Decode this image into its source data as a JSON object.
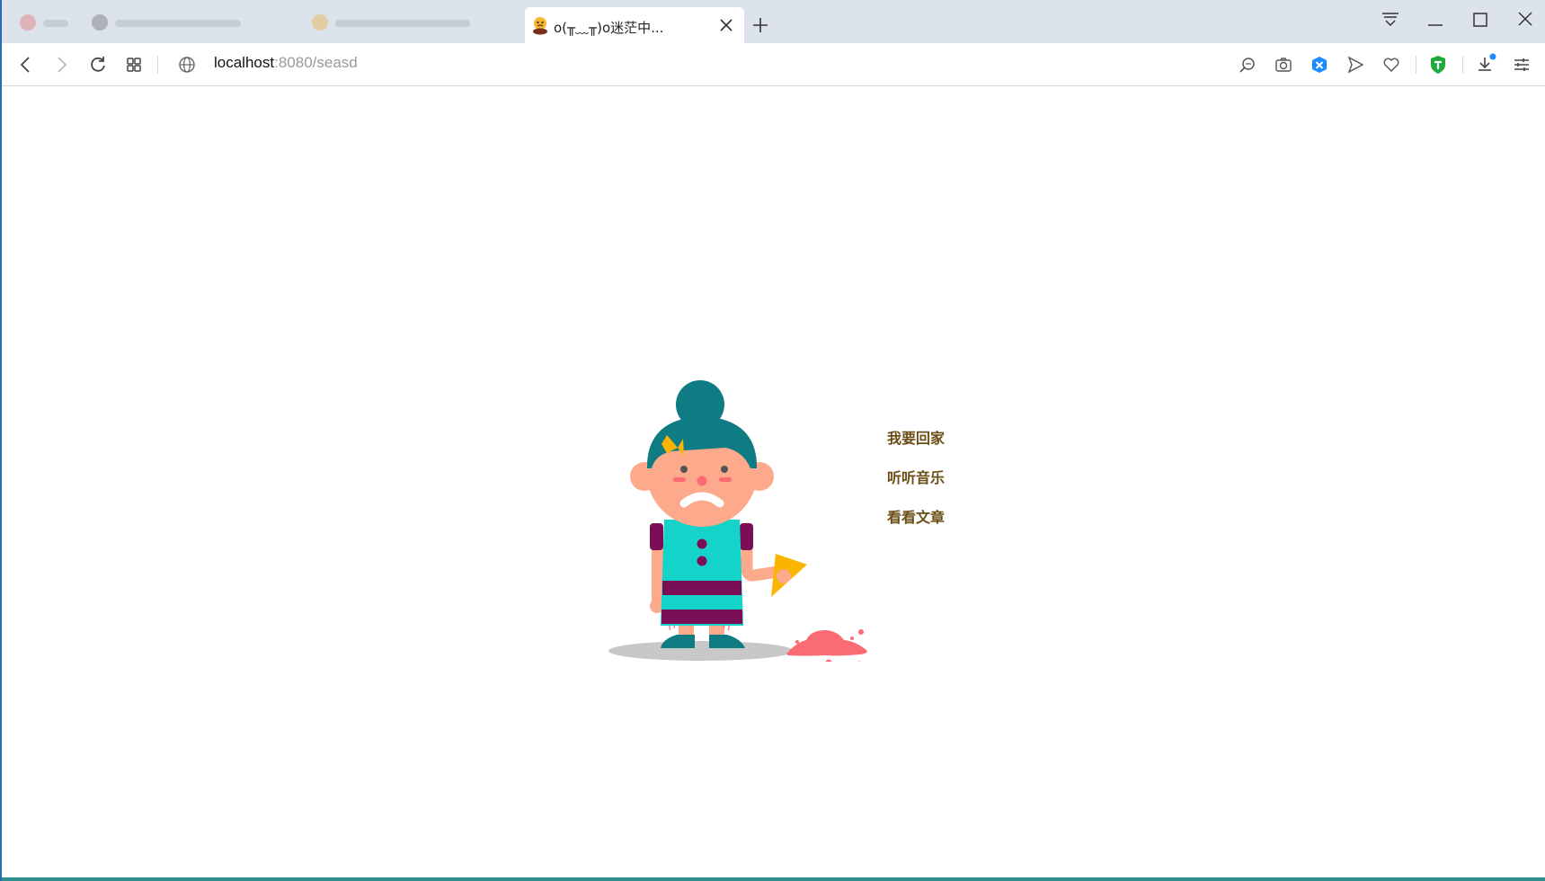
{
  "browser": {
    "tab": {
      "title": "o(╥﹏╥)o迷茫中...",
      "favicon": "crying-face-icon"
    },
    "address_bar": {
      "host": "localhost",
      "path": ":8080/seasd"
    },
    "icons": {
      "back": "back-arrow-icon",
      "forward": "forward-arrow-icon",
      "reload": "reload-icon",
      "apps": "grid-icon",
      "site_info": "globe-icon",
      "search": "search-icon",
      "screenshot": "camera-icon",
      "extension": "blue-extension-icon",
      "send": "send-icon",
      "favorite": "heart-icon",
      "shield": "shield-icon",
      "downloads": "download-icon",
      "menu": "settings-sliders-icon"
    }
  },
  "page": {
    "links": [
      {
        "label": "我要回家"
      },
      {
        "label": "听听音乐"
      },
      {
        "label": "看看文章"
      }
    ]
  },
  "colors": {
    "tabstrip_bg": "#dde3ea",
    "link_color": "#6b4e16",
    "hair": "#0f7b83",
    "dress": "#14d3c8",
    "stripe": "#7a0f55",
    "skin": "#fda98c",
    "icecream": "#fbb400",
    "splat": "#fb6b73"
  }
}
